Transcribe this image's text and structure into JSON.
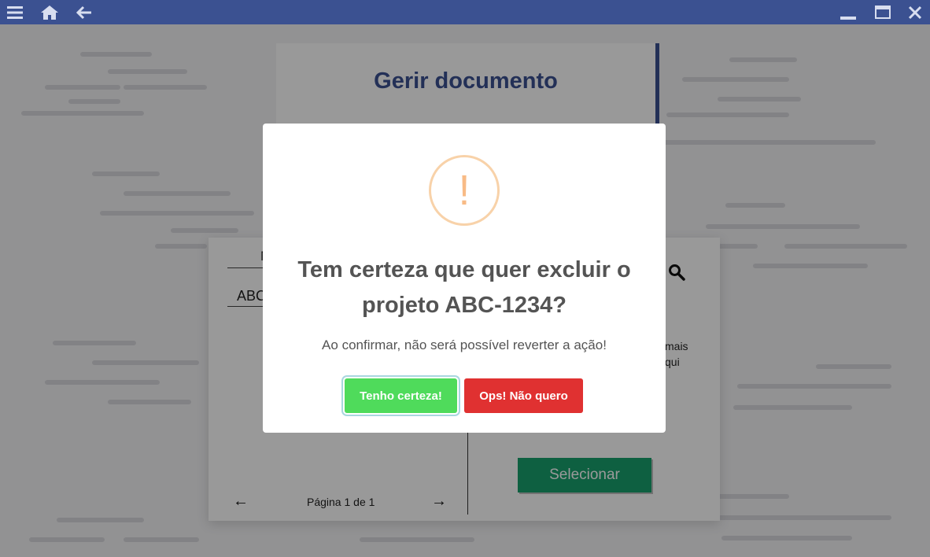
{
  "titlebar": {
    "color": "#3b5191",
    "left_icons": [
      "menu-icon",
      "home-icon",
      "back-arrow-icon"
    ],
    "right_icons": [
      "minimize-icon",
      "maximize-icon",
      "close-icon"
    ]
  },
  "page": {
    "title": "Gerir documento",
    "table": {
      "header_fragment": "N",
      "cell_fragment": "ABC"
    },
    "pager": {
      "prev": "←",
      "text": "Página 1 de 1",
      "next": "→"
    },
    "info_fragment_1": "mais",
    "info_fragment_2": "qui",
    "select_label": "Selecionar"
  },
  "modal": {
    "icon": "!",
    "title": "Tem certeza que quer excluir o projeto ABC-1234?",
    "text": "Ao confirmar, não será possível reverter a ação!",
    "confirm_label": "Tenho certeza!",
    "cancel_label": "Ops! Não quero",
    "colors": {
      "confirm": "#4fdb5b",
      "cancel": "#e03131",
      "warning": "#f8bb86"
    }
  }
}
